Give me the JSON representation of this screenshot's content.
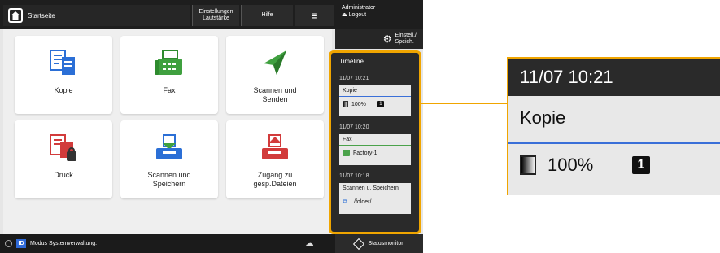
{
  "topbar": {
    "home_label": "Startseite",
    "settings_label": "Einstellungen\nLautstärke",
    "help_label": "Hilfe",
    "menu_glyph": "≡",
    "admin_line1": "Administrator",
    "admin_logout": "Logout"
  },
  "tiles": [
    {
      "label": "Kopie",
      "icon": "copy-icon"
    },
    {
      "label": "Fax",
      "icon": "fax-icon"
    },
    {
      "label": "Scannen und\nSenden",
      "icon": "scan-send-icon"
    },
    {
      "label": "Druck",
      "icon": "print-icon"
    },
    {
      "label": "Scannen und\nSpeichern",
      "icon": "scan-store-icon"
    },
    {
      "label": "Zugang zu\ngesp.Dateien",
      "icon": "stored-files-icon"
    }
  ],
  "settings_row": {
    "label": "Einstell./\nSpeich."
  },
  "timeline": {
    "title": "Timeline",
    "entries": [
      {
        "time": "11/07 10:21",
        "name": "Kopie",
        "value": "100%",
        "badge": "1"
      },
      {
        "time": "11/07 10:20",
        "name": "Fax",
        "value": "Factory-1"
      },
      {
        "time": "11/07 10:18",
        "name": "Scannen u. Speichern",
        "value": "/folder/"
      }
    ]
  },
  "bottombar": {
    "id_badge": "ID",
    "status_text": "Modus Systemverwaltung.",
    "monitor_label": "Statusmonitor"
  },
  "zoom": {
    "time": "11/07 10:21",
    "name": "Kopie",
    "value": "100%",
    "badge": "1"
  },
  "colors": {
    "accent": "#f0a500",
    "kopie_line": "#3a6fd8",
    "fax_line": "#4aa24a"
  }
}
